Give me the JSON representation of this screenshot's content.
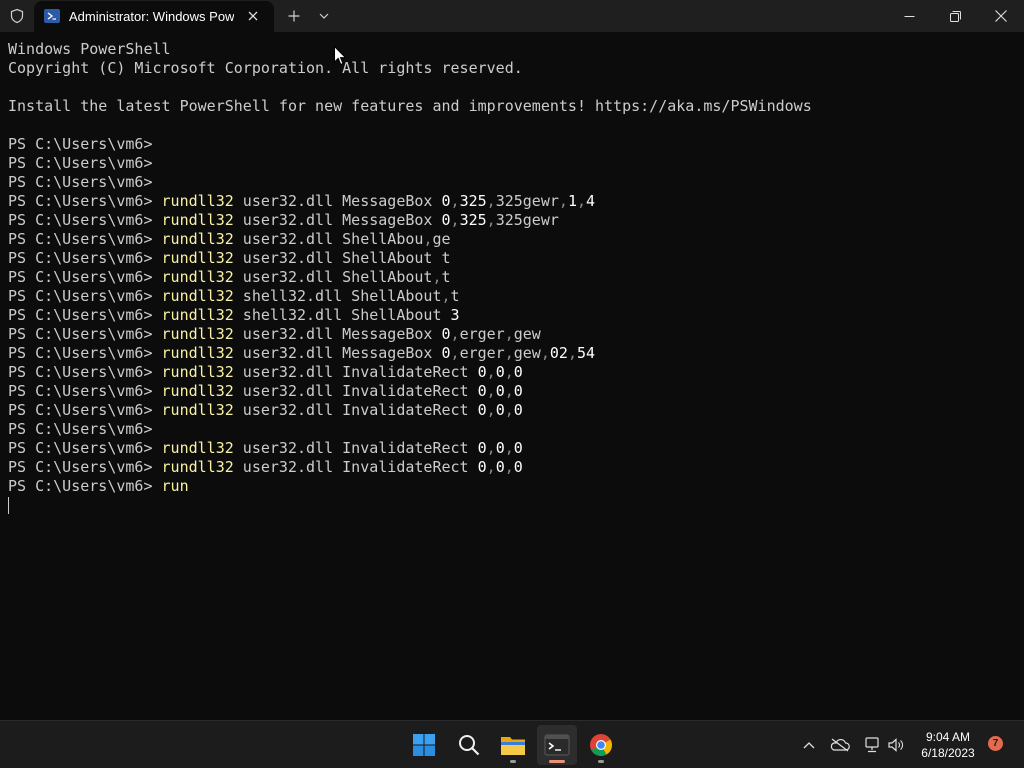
{
  "window": {
    "tab_title": "Administrator: Windows PowerShell"
  },
  "terminal": {
    "lines": [
      [
        {
          "t": "Windows PowerShell",
          "c": ""
        }
      ],
      [
        {
          "t": "Copyright (C) Microsoft Corporation. All rights reserved.",
          "c": ""
        }
      ],
      [
        {
          "t": "",
          "c": ""
        }
      ],
      [
        {
          "t": "Install the latest PowerShell for new features and improvements! https://aka.ms/PSWindows",
          "c": ""
        }
      ],
      [
        {
          "t": "",
          "c": ""
        }
      ],
      [
        {
          "t": "PS C:\\Users\\vm6>",
          "c": ""
        }
      ],
      [
        {
          "t": "PS C:\\Users\\vm6>",
          "c": ""
        }
      ],
      [
        {
          "t": "PS C:\\Users\\vm6>",
          "c": ""
        }
      ],
      [
        {
          "t": "PS C:\\Users\\vm6> ",
          "c": ""
        },
        {
          "t": "rundll32",
          "c": "cmd"
        },
        {
          "t": " user32.dll MessageBox ",
          "c": ""
        },
        {
          "t": "0",
          "c": "num"
        },
        {
          "t": ",",
          "c": "sep"
        },
        {
          "t": "325",
          "c": "num"
        },
        {
          "t": ",",
          "c": "sep"
        },
        {
          "t": "325gewr",
          "c": ""
        },
        {
          "t": ",",
          "c": "sep"
        },
        {
          "t": "1",
          "c": "num"
        },
        {
          "t": ",",
          "c": "sep"
        },
        {
          "t": "4",
          "c": "num"
        }
      ],
      [
        {
          "t": "PS C:\\Users\\vm6> ",
          "c": ""
        },
        {
          "t": "rundll32",
          "c": "cmd"
        },
        {
          "t": " user32.dll MessageBox ",
          "c": ""
        },
        {
          "t": "0",
          "c": "num"
        },
        {
          "t": ",",
          "c": "sep"
        },
        {
          "t": "325",
          "c": "num"
        },
        {
          "t": ",",
          "c": "sep"
        },
        {
          "t": "325gewr",
          "c": ""
        }
      ],
      [
        {
          "t": "PS C:\\Users\\vm6> ",
          "c": ""
        },
        {
          "t": "rundll32",
          "c": "cmd"
        },
        {
          "t": " user32.dll ShellAbou",
          "c": ""
        },
        {
          "t": ",",
          "c": "sep"
        },
        {
          "t": "ge",
          "c": ""
        }
      ],
      [
        {
          "t": "PS C:\\Users\\vm6> ",
          "c": ""
        },
        {
          "t": "rundll32",
          "c": "cmd"
        },
        {
          "t": " user32.dll ShellAbout t",
          "c": ""
        }
      ],
      [
        {
          "t": "PS C:\\Users\\vm6> ",
          "c": ""
        },
        {
          "t": "rundll32",
          "c": "cmd"
        },
        {
          "t": " user32.dll ShellAbout",
          "c": ""
        },
        {
          "t": ",",
          "c": "sep"
        },
        {
          "t": "t",
          "c": ""
        }
      ],
      [
        {
          "t": "PS C:\\Users\\vm6> ",
          "c": ""
        },
        {
          "t": "rundll32",
          "c": "cmd"
        },
        {
          "t": " shell32.dll ShellAbout",
          "c": ""
        },
        {
          "t": ",",
          "c": "sep"
        },
        {
          "t": "t",
          "c": ""
        }
      ],
      [
        {
          "t": "PS C:\\Users\\vm6> ",
          "c": ""
        },
        {
          "t": "rundll32",
          "c": "cmd"
        },
        {
          "t": " shell32.dll ShellAbout ",
          "c": ""
        },
        {
          "t": "3",
          "c": "num"
        }
      ],
      [
        {
          "t": "PS C:\\Users\\vm6> ",
          "c": ""
        },
        {
          "t": "rundll32",
          "c": "cmd"
        },
        {
          "t": " user32.dll MessageBox ",
          "c": ""
        },
        {
          "t": "0",
          "c": "num"
        },
        {
          "t": ",",
          "c": "sep"
        },
        {
          "t": "erger",
          "c": ""
        },
        {
          "t": ",",
          "c": "sep"
        },
        {
          "t": "gew",
          "c": ""
        }
      ],
      [
        {
          "t": "PS C:\\Users\\vm6> ",
          "c": ""
        },
        {
          "t": "rundll32",
          "c": "cmd"
        },
        {
          "t": " user32.dll MessageBox ",
          "c": ""
        },
        {
          "t": "0",
          "c": "num"
        },
        {
          "t": ",",
          "c": "sep"
        },
        {
          "t": "erger",
          "c": ""
        },
        {
          "t": ",",
          "c": "sep"
        },
        {
          "t": "gew",
          "c": ""
        },
        {
          "t": ",",
          "c": "sep"
        },
        {
          "t": "02",
          "c": "num"
        },
        {
          "t": ",",
          "c": "sep"
        },
        {
          "t": "54",
          "c": "num"
        }
      ],
      [
        {
          "t": "PS C:\\Users\\vm6> ",
          "c": ""
        },
        {
          "t": "rundll32",
          "c": "cmd"
        },
        {
          "t": " user32.dll InvalidateRect ",
          "c": ""
        },
        {
          "t": "0",
          "c": "num"
        },
        {
          "t": ",",
          "c": "sep"
        },
        {
          "t": "0",
          "c": "num"
        },
        {
          "t": ",",
          "c": "sep"
        },
        {
          "t": "0",
          "c": "num"
        }
      ],
      [
        {
          "t": "PS C:\\Users\\vm6> ",
          "c": ""
        },
        {
          "t": "rundll32",
          "c": "cmd"
        },
        {
          "t": " user32.dll InvalidateRect ",
          "c": ""
        },
        {
          "t": "0",
          "c": "num"
        },
        {
          "t": ",",
          "c": "sep"
        },
        {
          "t": "0",
          "c": "num"
        },
        {
          "t": ",",
          "c": "sep"
        },
        {
          "t": "0",
          "c": "num"
        }
      ],
      [
        {
          "t": "PS C:\\Users\\vm6> ",
          "c": ""
        },
        {
          "t": "rundll32",
          "c": "cmd"
        },
        {
          "t": " user32.dll InvalidateRect ",
          "c": ""
        },
        {
          "t": "0",
          "c": "num"
        },
        {
          "t": ",",
          "c": "sep"
        },
        {
          "t": "0",
          "c": "num"
        },
        {
          "t": ",",
          "c": "sep"
        },
        {
          "t": "0",
          "c": "num"
        }
      ],
      [
        {
          "t": "PS C:\\Users\\vm6>",
          "c": ""
        }
      ],
      [
        {
          "t": "PS C:\\Users\\vm6> ",
          "c": ""
        },
        {
          "t": "rundll32",
          "c": "cmd"
        },
        {
          "t": " user32.dll InvalidateRect ",
          "c": ""
        },
        {
          "t": "0",
          "c": "num"
        },
        {
          "t": ",",
          "c": "sep"
        },
        {
          "t": "0",
          "c": "num"
        },
        {
          "t": ",",
          "c": "sep"
        },
        {
          "t": "0",
          "c": "num"
        }
      ],
      [
        {
          "t": "PS C:\\Users\\vm6> ",
          "c": ""
        },
        {
          "t": "rundll32",
          "c": "cmd"
        },
        {
          "t": " user32.dll InvalidateRect ",
          "c": ""
        },
        {
          "t": "0",
          "c": "num"
        },
        {
          "t": ",",
          "c": "sep"
        },
        {
          "t": "0",
          "c": "num"
        },
        {
          "t": ",",
          "c": "sep"
        },
        {
          "t": "0",
          "c": "num"
        }
      ],
      [
        {
          "t": "PS C:\\Users\\vm6> ",
          "c": ""
        },
        {
          "t": "run",
          "c": "cmd"
        }
      ]
    ],
    "colors": {
      "background": "#0c0c0c",
      "text": "#cccccc",
      "command": "#f9f1a5",
      "number": "#ffffff"
    }
  },
  "taskbar": {
    "apps": [
      {
        "name": "start-icon",
        "running": false
      },
      {
        "name": "search-icon",
        "running": false
      },
      {
        "name": "file-explorer-icon",
        "running": true
      },
      {
        "name": "terminal-icon",
        "running": true,
        "active": true
      },
      {
        "name": "chrome-icon",
        "running": true
      }
    ],
    "clock_time": "9:04 AM",
    "clock_date": "6/18/2023",
    "notification_count": "7"
  }
}
